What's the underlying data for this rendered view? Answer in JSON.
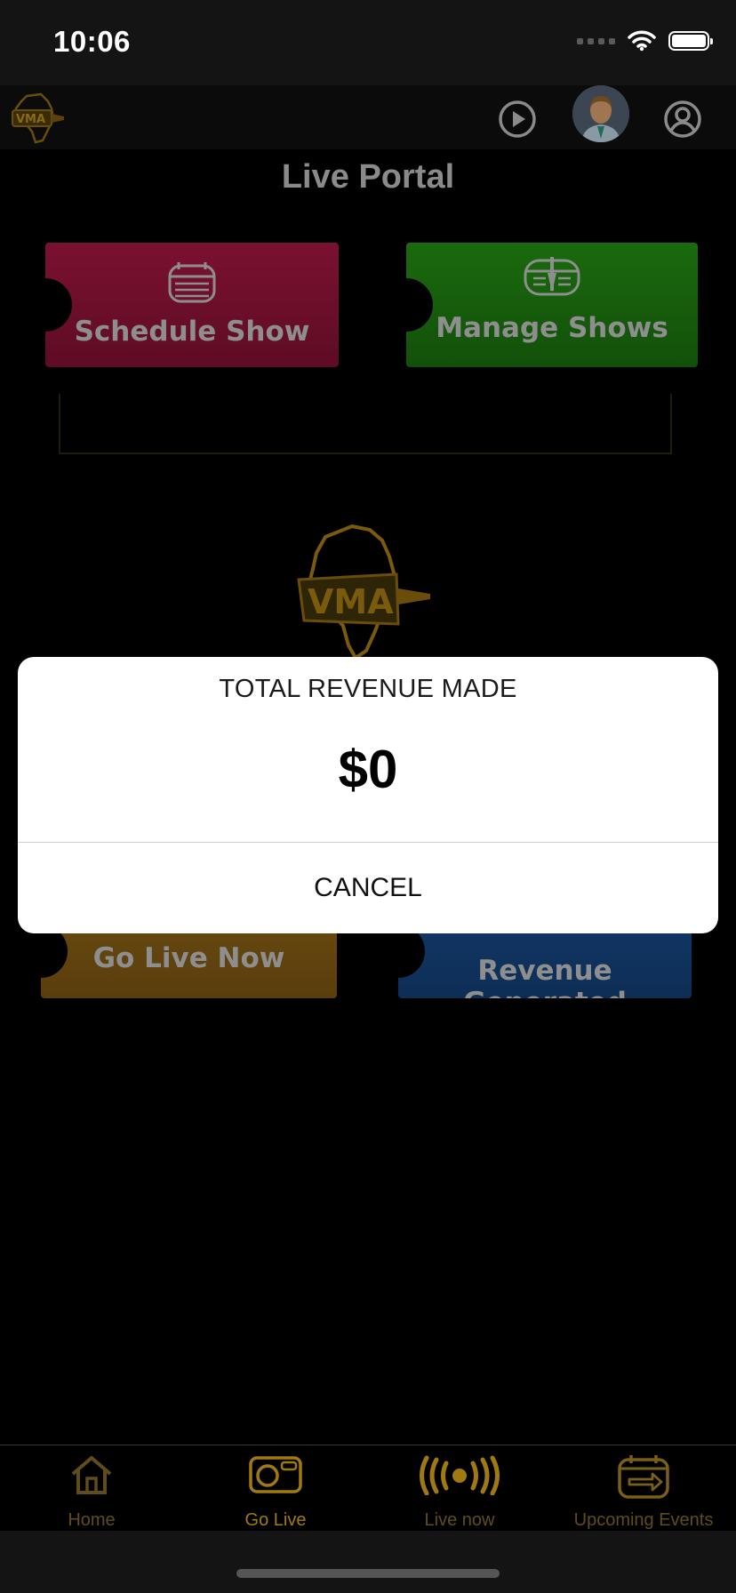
{
  "status_bar": {
    "time": "10:06"
  },
  "header": {
    "title": "Live Portal"
  },
  "tiles": {
    "schedule": "Schedule Show",
    "manage": "Manage Shows",
    "golive": "Go Live Now",
    "revenue": "Revenue Generated"
  },
  "dialog": {
    "title": "TOTAL REVENUE MADE",
    "amount": "$0",
    "cancel": "CANCEL"
  },
  "tab_bar": {
    "items": [
      {
        "label": "Home",
        "icon": "home-icon"
      },
      {
        "label": "Go Live",
        "icon": "camera-icon",
        "active": true
      },
      {
        "label": "Live now",
        "icon": "broadcast-icon"
      },
      {
        "label": "Upcoming Events",
        "icon": "calendar-arrow-icon"
      }
    ]
  },
  "colors": {
    "accent": "#a07a10",
    "schedule_tile": "#7a1130",
    "manage_tile": "#1a6a0d",
    "golive_tile": "#6a4a10",
    "revenue_tile": "#123a6a"
  }
}
